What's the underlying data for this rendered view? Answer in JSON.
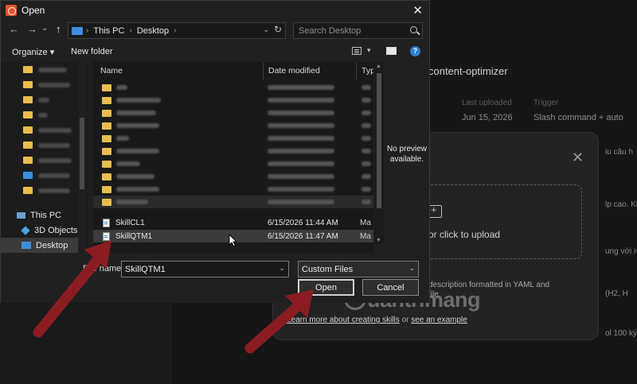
{
  "dialog": {
    "title": "Open",
    "close_glyph": "✕",
    "nav": {
      "back": "←",
      "forward": "→",
      "up": "↑",
      "recent": "⌄"
    },
    "breadcrumb": [
      "This PC",
      "Desktop"
    ],
    "search_placeholder": "Search Desktop",
    "toolbar": {
      "organize": "Organize ▾",
      "new_folder": "New folder"
    },
    "sidebar": [
      {
        "kind": "folder"
      },
      {
        "kind": "folder"
      },
      {
        "kind": "folder"
      },
      {
        "kind": "folder"
      },
      {
        "kind": "folder"
      },
      {
        "kind": "folder"
      },
      {
        "kind": "folder"
      },
      {
        "kind": "folder"
      },
      {
        "kind": "folder"
      },
      {
        "kind": "pc",
        "label": "This PC"
      },
      {
        "kind": "objects",
        "label": "3D Objects"
      },
      {
        "kind": "desktop",
        "label": "Desktop",
        "selected": true
      }
    ],
    "columns": {
      "name": "Name",
      "date": "Date modified",
      "type": "Typ"
    },
    "files": [
      {
        "kind": "folder",
        "blurred": true
      },
      {
        "kind": "folder",
        "blurred": true
      },
      {
        "kind": "folder",
        "blurred": true
      },
      {
        "kind": "folder",
        "blurred": true
      },
      {
        "kind": "folder",
        "blurred": true
      },
      {
        "kind": "folder",
        "blurred": true
      },
      {
        "kind": "folder",
        "blurred": true
      },
      {
        "kind": "folder",
        "blurred": true
      },
      {
        "kind": "folder",
        "blurred": true
      },
      {
        "kind": "folder",
        "blurred": true
      },
      {
        "kind": "file",
        "name": "SkillCL1",
        "date": "6/15/2026 11:44 AM",
        "type": "Ma"
      },
      {
        "kind": "file",
        "name": "SkillQTM1",
        "date": "6/15/2026 11:47 AM",
        "type": "Ma",
        "selected": true
      }
    ],
    "preview_text": "No preview available.",
    "file_name_label": "File name:",
    "file_name_value": "SkillQTM1",
    "file_type": "Custom Files",
    "open_button": "Open",
    "cancel_button": "Cancel"
  },
  "background": {
    "skill_title": "content-optimizer",
    "meta": [
      {
        "label": "Last uploaded",
        "value": "Jun 15, 2026"
      },
      {
        "label": "Trigger",
        "value": "Slash command + auto"
      }
    ],
    "side_snippets": [
      "iu câu h",
      "lp cao. Khi",
      "ung với m",
      "(H2, H",
      "ol 100 ký"
    ],
    "upload_text": "or click to upload",
    "description": "description formatted in YAML and file",
    "learn_more": "Learn more about creating skills",
    "learn_or": "or",
    "see_example": "see an example",
    "modal_close": "✕"
  },
  "watermark": "uantrimang",
  "colors": {
    "accent": "#3d8edc",
    "folder": "#e9bd4e",
    "arrow": "#8b1d22"
  }
}
